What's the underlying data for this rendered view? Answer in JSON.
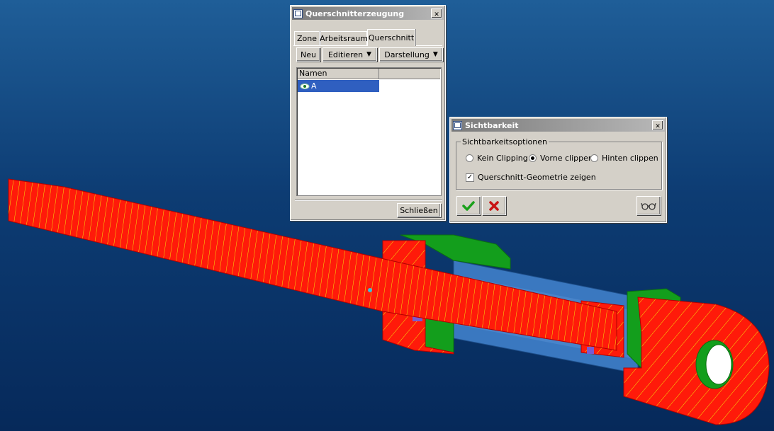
{
  "dialog1": {
    "title": "Querschnitterzeugung",
    "close_glyph": "✕",
    "tabs": [
      "Zone",
      "Arbeitsraum",
      "Querschnitt"
    ],
    "active_tab": "Querschnitt",
    "toolbar": {
      "new_label": "Neu",
      "edit_label": "Editieren",
      "display_label": "Darstellung"
    },
    "list": {
      "column_header": "Namen",
      "items": [
        {
          "name": "A",
          "selected": true
        }
      ]
    },
    "close_label": "Schließen"
  },
  "dialog2": {
    "title": "Sichtbarkeit",
    "close_glyph": "✕",
    "group_label": "Sichtbarkeitsoptionen",
    "options": [
      "Kein Clipping",
      "Vorne clippen",
      "Hinten clippen"
    ],
    "selected_option": "Vorne clippen",
    "checkbox_label": "Querschnitt-Geometrie zeigen",
    "checkbox_checked": true,
    "ok_icon": "checkmark-icon",
    "cancel_icon": "x-icon",
    "preview_icon": "glasses-icon"
  },
  "colors": {
    "section_red": "#ff1a0a",
    "hatch_yellow": "#f2e60a",
    "body_green": "#139e1c",
    "barrel_blue": "#3a78c0",
    "selection": "#2f5fc0"
  }
}
